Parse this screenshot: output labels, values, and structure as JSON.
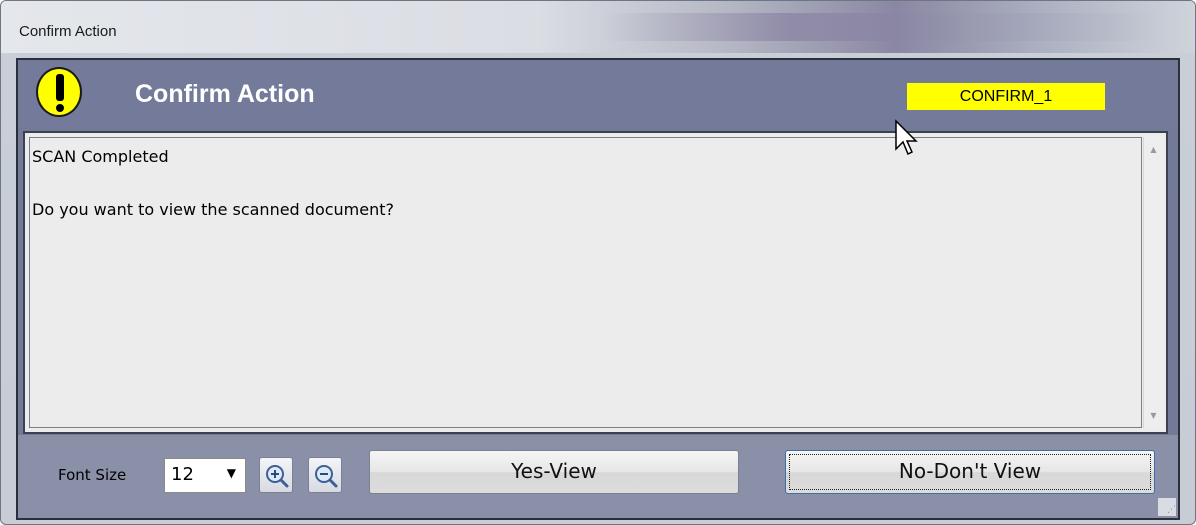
{
  "window": {
    "title": "Confirm Action"
  },
  "header": {
    "title": "Confirm Action",
    "code": "CONFIRM_1",
    "icon": "alert-exclamation-icon",
    "icon_color": "#ffff00",
    "badge_color": "#ffff00"
  },
  "message": {
    "lines": [
      "SCAN Completed",
      "Do you want to view the scanned document?"
    ]
  },
  "footer": {
    "font_size_label": "Font Size",
    "font_size_value": "12",
    "zoom_in_icon": "zoom-in-icon",
    "zoom_out_icon": "zoom-out-icon",
    "yes_label": "Yes-View",
    "no_label": "No-Don't View"
  },
  "colors": {
    "panel": "#737a9a",
    "footer": "#8a90a8",
    "accent_yellow": "#ffff00"
  }
}
